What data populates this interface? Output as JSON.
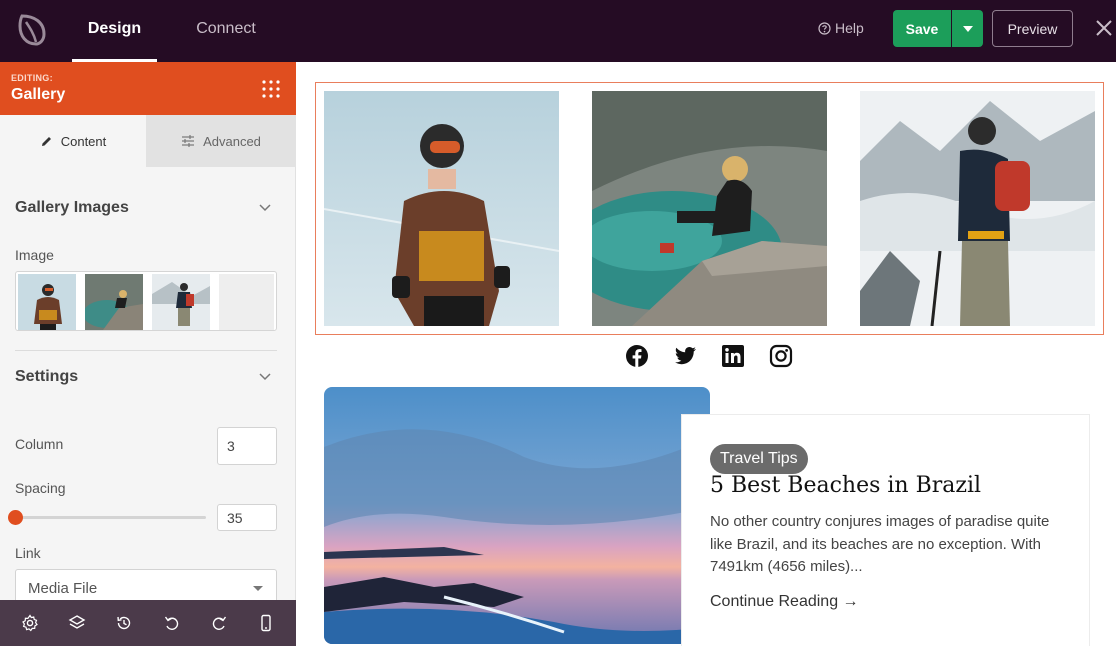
{
  "topbar": {
    "tabs": [
      {
        "label": "Design",
        "active": true
      },
      {
        "label": "Connect",
        "active": false
      }
    ],
    "help_label": "Help",
    "save_label": "Save",
    "preview_label": "Preview"
  },
  "sidebar": {
    "editing_label": "EDITING:",
    "editing_title": "Gallery",
    "subtabs": [
      {
        "label": "Content",
        "icon": "pencil-icon",
        "active": true
      },
      {
        "label": "Advanced",
        "icon": "sliders-icon",
        "active": false
      }
    ],
    "gallery_section": {
      "title": "Gallery Images",
      "image_label": "Image"
    },
    "settings_section": {
      "title": "Settings",
      "column_label": "Column",
      "column_value": "3",
      "spacing_label": "Spacing",
      "spacing_value": "35",
      "link_label": "Link",
      "link_value": "Media File"
    },
    "bottom_icons": [
      "gear-icon",
      "layers-icon",
      "history-icon",
      "undo-icon",
      "redo-icon",
      "mobile-icon"
    ]
  },
  "canvas": {
    "social_icons": [
      "facebook-icon",
      "twitter-icon",
      "linkedin-icon",
      "instagram-icon"
    ],
    "post": {
      "badge": "Travel Tips",
      "title": "5 Best Beaches in Brazil",
      "excerpt": "No other country conjures images of paradise quite like Brazil, and its beaches are no exception. With 7491km (4656 miles)...",
      "continue_label": "Continue Reading →"
    }
  },
  "colors": {
    "topbar_bg": "#250c24",
    "accent_orange": "#e04e1f",
    "save_green": "#1c9e5a",
    "bottombar_bg": "#4b3a4a"
  }
}
